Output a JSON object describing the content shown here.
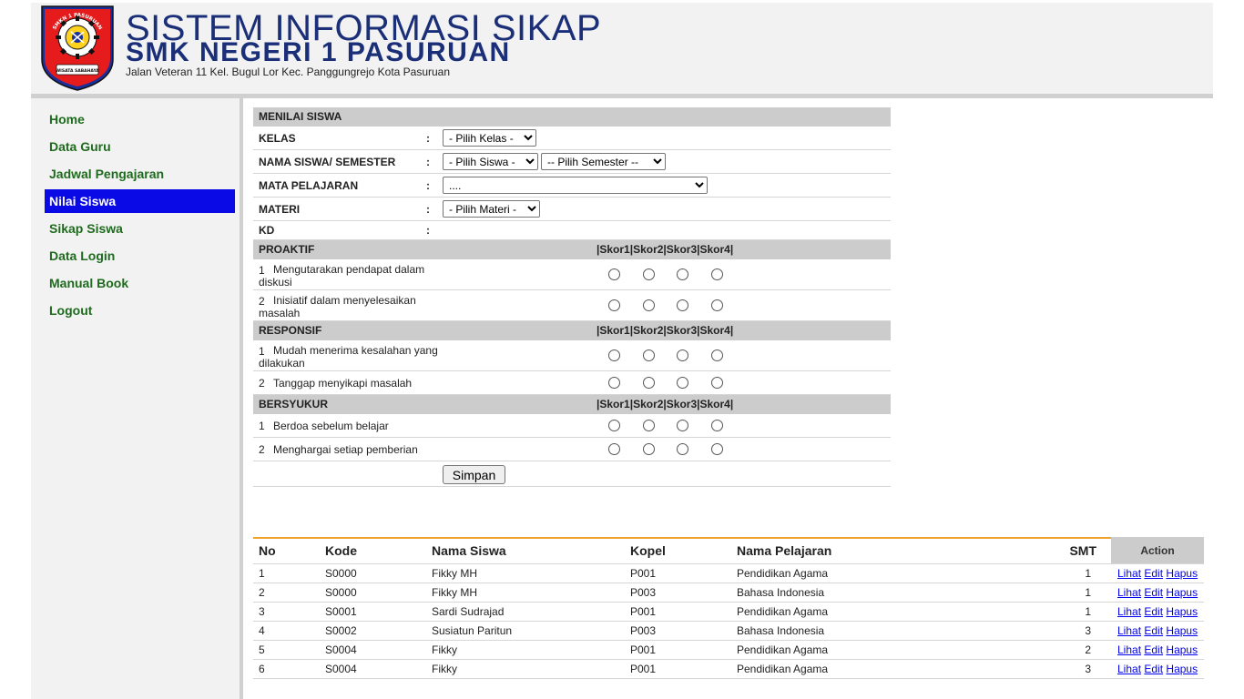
{
  "header": {
    "title": "SISTEM INFORMASI SIKAP",
    "school": "SMK NEGERI 1 PASURUAN",
    "address": "Jalan Veteran 11 Kel. Bugul Lor Kec. Panggungrejo Kota Pasuruan",
    "logo_top_text": "SMKN 1 PASURUAN",
    "logo_bottom_text": "WISATA SABAHAYA"
  },
  "nav": {
    "items": [
      "Home",
      "Data Guru",
      "Jadwal Pengajaran",
      "Nilai Siswa",
      "Sikap Siswa",
      "Data Login",
      "Manual Book",
      "Logout"
    ],
    "active": "Nilai Siswa"
  },
  "form": {
    "title": "MENILAI SISWA",
    "colon": ":",
    "kelas_label": "KELAS",
    "kelas_select": "- Pilih Kelas -",
    "siswa_label": "NAMA SISWA/ SEMESTER",
    "siswa_select": "- Pilih Siswa -",
    "semester_select": "-- Pilih Semester --",
    "mapel_label": "MATA PELAJARAN",
    "mapel_select": "....",
    "materi_label": "MATERI",
    "materi_select": "- Pilih Materi -",
    "kd_label": "KD",
    "score_header": "|Skor1|Skor2|Skor3|Skor4|",
    "sections": [
      {
        "name": "PROAKTIF",
        "items": [
          {
            "no": "1",
            "text": "Mengutarakan pendapat dalam diskusi"
          },
          {
            "no": "2",
            "text": "Inisiatif dalam menyelesaikan masalah"
          }
        ]
      },
      {
        "name": "RESPONSIF",
        "items": [
          {
            "no": "1",
            "text": "Mudah menerima kesalahan yang dilakukan"
          },
          {
            "no": "2",
            "text": "Tanggap menyikapi masalah"
          }
        ]
      },
      {
        "name": "BERSYUKUR",
        "items": [
          {
            "no": "1",
            "text": "Berdoa sebelum belajar"
          },
          {
            "no": "2",
            "text": "Menghargai setiap pemberian"
          }
        ]
      }
    ],
    "save_label": "Simpan"
  },
  "table": {
    "headers": {
      "no": "No",
      "kode": "Kode",
      "nama": "Nama Siswa",
      "kopel": "Kopel",
      "pelajaran": "Nama Pelajaran",
      "smt": "SMT",
      "action": "Action"
    },
    "rows": [
      {
        "no": "1",
        "kode": "S0000",
        "nama": "Fikky MH",
        "kopel": "P001",
        "pelajaran": "Pendidikan Agama",
        "smt": "1"
      },
      {
        "no": "2",
        "kode": "S0000",
        "nama": "Fikky MH",
        "kopel": "P003",
        "pelajaran": "Bahasa Indonesia",
        "smt": "1"
      },
      {
        "no": "3",
        "kode": "S0001",
        "nama": "Sardi Sudrajad",
        "kopel": "P001",
        "pelajaran": "Pendidikan Agama",
        "smt": "1"
      },
      {
        "no": "4",
        "kode": "S0002",
        "nama": "Susiatun Paritun",
        "kopel": "P003",
        "pelajaran": "Bahasa Indonesia",
        "smt": "3"
      },
      {
        "no": "5",
        "kode": "S0004",
        "nama": "Fikky",
        "kopel": "P001",
        "pelajaran": "Pendidikan Agama",
        "smt": "2"
      },
      {
        "no": "6",
        "kode": "S0004",
        "nama": "Fikky",
        "kopel": "P001",
        "pelajaran": "Pendidikan Agama",
        "smt": "3"
      }
    ],
    "actions": {
      "view": "Lihat",
      "edit": "Edit",
      "delete": "Hapus"
    }
  },
  "colors": {
    "title_blue": "#1a2f78",
    "nav_green": "#1e6b1e",
    "nav_active_bg": "#0a0ae6",
    "table_accent": "#f0a22a",
    "section_gray": "#cccccc"
  },
  "icons": {
    "logo": "school-crest-gear-icon",
    "select": "chevron-down-icon",
    "score": "radio-button-icon"
  }
}
